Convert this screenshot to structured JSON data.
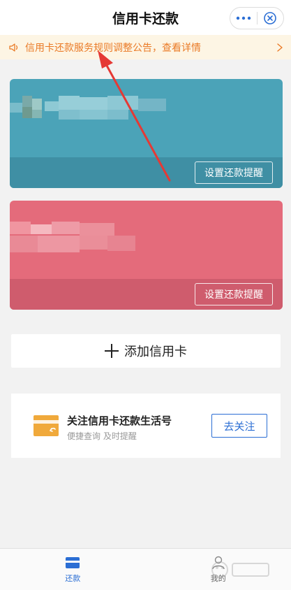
{
  "header": {
    "title": "信用卡还款",
    "more_icon": "more-dots-icon",
    "close_icon": "close-target-icon"
  },
  "notice": {
    "text": "信用卡还款服务规则调整公告，查看详情",
    "icon": "speaker-icon",
    "color": "#ea7a26"
  },
  "cards": [
    {
      "color": "#4ba3b8",
      "reminder_label": "设置还款提醒"
    },
    {
      "color": "#e46b7b",
      "reminder_label": "设置还款提醒"
    }
  ],
  "add_card": {
    "label": "添加信用卡",
    "icon": "plus-icon"
  },
  "follow": {
    "title": "关注信用卡还款生活号",
    "subtitle": "便捷查询 及时提醒",
    "button_label": "去关注",
    "icon": "card-envelope-icon",
    "accent": "#2b6ed4"
  },
  "tabbar": {
    "tabs": [
      {
        "label": "还款",
        "icon": "card-icon",
        "active": true
      },
      {
        "label": "我的",
        "icon": "person-icon",
        "active": false
      }
    ]
  },
  "annotation": {
    "icon": "red-arrow-icon",
    "color": "#e53935"
  }
}
